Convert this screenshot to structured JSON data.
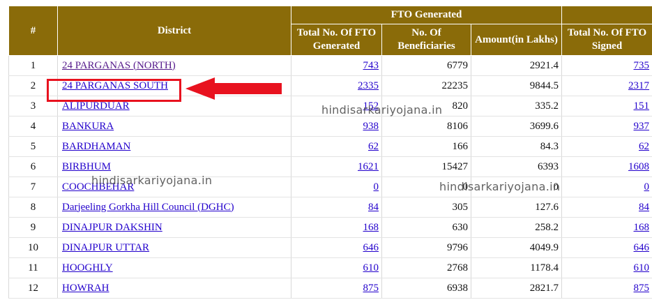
{
  "header": {
    "hash": "#",
    "district": "District",
    "fto_generated_group": "FTO Generated",
    "total_fto_generated": "Total No. Of FTO Generated",
    "beneficiaries": "No. Of Beneficiaries",
    "amount": "Amount(in Lakhs)",
    "total_fto_signed": "Total No. Of FTO Signed"
  },
  "rows": [
    {
      "sn": "1",
      "district": "24 PARGANAS (NORTH)",
      "fto": "743",
      "ben": "6779",
      "amount": "2921.4",
      "signed": "735"
    },
    {
      "sn": "2",
      "district": "24 PARGANAS SOUTH",
      "fto": "2335",
      "ben": "22235",
      "amount": "9844.5",
      "signed": "2317"
    },
    {
      "sn": "3",
      "district": "ALIPURDUAR",
      "fto": "152",
      "ben": "820",
      "amount": "335.2",
      "signed": "151"
    },
    {
      "sn": "4",
      "district": "BANKURA",
      "fto": "938",
      "ben": "8106",
      "amount": "3699.6",
      "signed": "937"
    },
    {
      "sn": "5",
      "district": "BARDHAMAN",
      "fto": "62",
      "ben": "166",
      "amount": "84.3",
      "signed": "62"
    },
    {
      "sn": "6",
      "district": "BIRBHUM",
      "fto": "1621",
      "ben": "15427",
      "amount": "6393",
      "signed": "1608"
    },
    {
      "sn": "7",
      "district": "COOCHBEHAR",
      "fto": "0",
      "ben": "0",
      "amount": "0",
      "signed": "0"
    },
    {
      "sn": "8",
      "district": "Darjeeling Gorkha Hill Council (DGHC)",
      "fto": "84",
      "ben": "305",
      "amount": "127.6",
      "signed": "84"
    },
    {
      "sn": "9",
      "district": "DINAJPUR DAKSHIN",
      "fto": "168",
      "ben": "630",
      "amount": "258.2",
      "signed": "168"
    },
    {
      "sn": "10",
      "district": "DINAJPUR UTTAR",
      "fto": "646",
      "ben": "9796",
      "amount": "4049.9",
      "signed": "646"
    },
    {
      "sn": "11",
      "district": "HOOGHLY",
      "fto": "610",
      "ben": "2768",
      "amount": "1178.4",
      "signed": "610"
    },
    {
      "sn": "12",
      "district": "HOWRAH",
      "fto": "875",
      "ben": "6938",
      "amount": "2821.7",
      "signed": "875"
    }
  ],
  "watermarks": [
    "hindisarkariyojana.in",
    "hindisarkariyojana.in",
    "hindisarkariyojana.in"
  ],
  "colors": {
    "header_bg": "#8a6b09",
    "link": "#2200cc",
    "highlight": "#e8121f"
  }
}
